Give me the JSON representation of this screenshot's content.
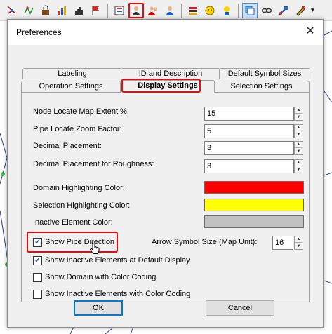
{
  "toolbar": {
    "buttons": [
      {
        "icon": "pointer-network-icon"
      },
      {
        "icon": "links-icon"
      },
      {
        "icon": "lock-box-icon"
      },
      {
        "icon": "chart-color-icon"
      },
      {
        "icon": "bar-chart-icon"
      },
      {
        "icon": "flag-chart-icon"
      },
      {
        "icon": "settings-list-icon"
      },
      {
        "icon": "user-preferences-icon"
      },
      {
        "icon": "users-icon"
      },
      {
        "icon": "user-group-icon"
      },
      {
        "icon": "stack-icon"
      },
      {
        "icon": "smiley-icon"
      },
      {
        "icon": "lock-user-icon"
      },
      {
        "icon": "layers-icon"
      },
      {
        "icon": "chain-link-icon"
      },
      {
        "icon": "move-arrow-icon"
      },
      {
        "icon": "pencil-flag-icon"
      }
    ]
  },
  "dialog": {
    "title": "Preferences",
    "tabs_back": [
      "Labeling",
      "ID and Description",
      "Default Symbol Sizes"
    ],
    "tabs_front": [
      "Operation Settings",
      "Display Settings",
      "Selection Settings"
    ],
    "selected_tab": "Display Settings",
    "fields": {
      "node_locate_label": "Node Locate Map Extent %:",
      "node_locate_value": "15",
      "pipe_zoom_label": "Pipe Locate Zoom Factor:",
      "pipe_zoom_value": "5",
      "decimal_label": "Decimal Placement:",
      "decimal_value": "3",
      "roughness_label": "Decimal Placement for Roughness:",
      "roughness_value": "3",
      "domain_color_label": "Domain Highlighting Color:",
      "selection_color_label": "Selection Highlighting Color:",
      "inactive_color_label": "Inactive Element Color:",
      "arrow_size_label": "Arrow Symbol Size (Map Unit):",
      "arrow_size_value": "16"
    },
    "colors": {
      "domain": "#ff0000",
      "selection": "#ffff00",
      "inactive": "#c0c0c0",
      "highlight_box": "#e01010"
    },
    "checkboxes": {
      "show_pipe_direction": {
        "label": "Show Pipe Direction",
        "checked": true
      },
      "show_inactive_default": {
        "label": "Show Inactive Elements at Default Display",
        "checked": true
      },
      "show_domain_color": {
        "label": "Show Domain with Color Coding",
        "checked": false
      },
      "show_inactive_color": {
        "label": "Show Inactive Elements with Color Coding",
        "checked": false
      }
    },
    "buttons": {
      "ok": "OK",
      "cancel": "Cancel"
    }
  }
}
